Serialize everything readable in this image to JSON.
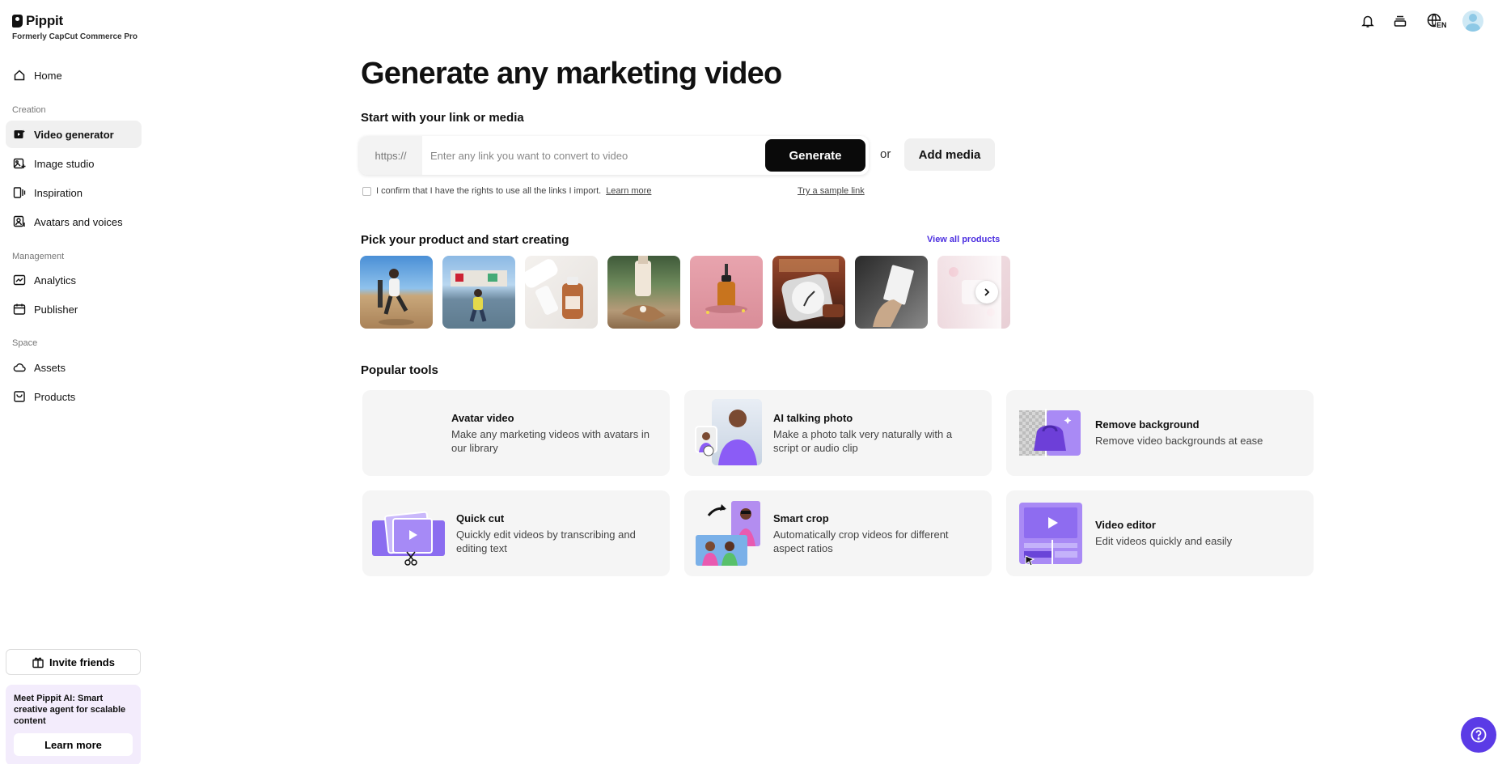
{
  "brand": {
    "name": "Pippit",
    "subtitle": "Formerly CapCut Commerce Pro"
  },
  "sidebar": {
    "home": {
      "label": "Home",
      "icon": "home-icon"
    },
    "creation_label": "Creation",
    "creation_items": [
      {
        "label": "Video generator",
        "icon": "video-generator-icon",
        "active": true
      },
      {
        "label": "Image studio",
        "icon": "image-studio-icon"
      },
      {
        "label": "Inspiration",
        "icon": "inspiration-icon"
      },
      {
        "label": "Avatars and voices",
        "icon": "avatar-voice-icon"
      }
    ],
    "management_label": "Management",
    "management_items": [
      {
        "label": "Analytics",
        "icon": "analytics-icon"
      },
      {
        "label": "Publisher",
        "icon": "calendar-icon"
      }
    ],
    "space_label": "Space",
    "space_items": [
      {
        "label": "Assets",
        "icon": "cloud-icon"
      },
      {
        "label": "Products",
        "icon": "product-bag-icon"
      }
    ],
    "invite_label": "Invite friends",
    "promo": {
      "text": "Meet Pippit AI: Smart creative agent for scalable content",
      "button": "Learn more"
    }
  },
  "topbar": {
    "language": "EN"
  },
  "main": {
    "title": "Generate any marketing video",
    "link_section_label": "Start with your link or media",
    "link_prefix": "https://",
    "link_placeholder": "Enter any link you want to convert to video",
    "generate_label": "Generate",
    "or_label": "or",
    "add_media_label": "Add media",
    "confirm_text": "I confirm that I have the rights to use all the links I import.",
    "confirm_learn_more": "Learn more",
    "sample_link": "Try a sample link",
    "products_label": "Pick your product and start creating",
    "view_all": "View all products",
    "tools_label": "Popular tools",
    "tools": [
      {
        "title": "Avatar video",
        "desc": "Make any marketing videos with avatars in our library"
      },
      {
        "title": "AI talking photo",
        "desc": "Make a photo talk very naturally with a script or audio clip"
      },
      {
        "title": "Remove background",
        "desc": "Remove video backgrounds at ease"
      },
      {
        "title": "Quick cut",
        "desc": "Quickly edit videos by transcribing and editing text"
      },
      {
        "title": "Smart crop",
        "desc": "Automatically crop videos for different aspect ratios"
      },
      {
        "title": "Video editor",
        "desc": "Edit videos quickly and easily"
      }
    ]
  },
  "colors": {
    "accent": "#5b3be6",
    "link_purple": "#4b2ee0",
    "primary_button": "#0a0a0a",
    "card_bg": "#f5f5f5",
    "promo_bg": "#f3ecfc"
  }
}
